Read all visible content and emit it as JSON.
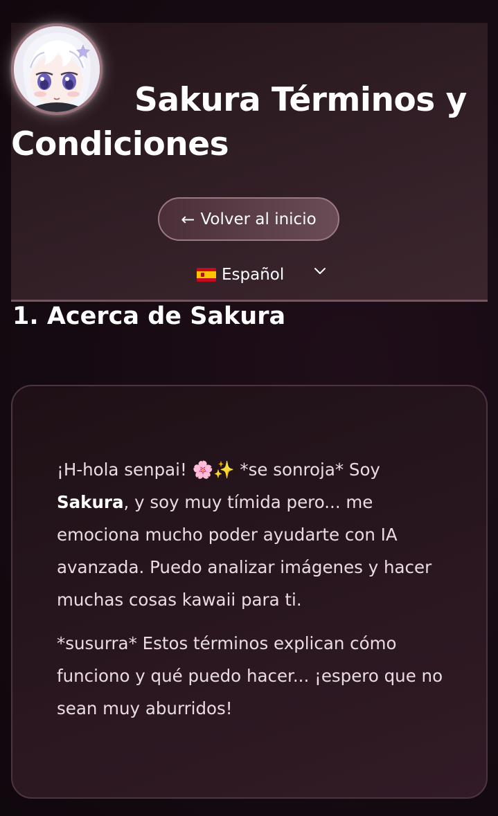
{
  "header": {
    "title": "Sakura Términos y Condiciones",
    "back_button": {
      "arrow": "←",
      "label": "Volver al inicio"
    },
    "language": {
      "selected": "Español",
      "flag_icon": "spain-flag-icon",
      "chevron_icon": "chevron-down-icon"
    }
  },
  "section": {
    "title": "1. Acerca de Sakura"
  },
  "card": {
    "p1_before": "¡H-hola senpai! 🌸✨ *se sonroja* Soy ",
    "p1_bold": "Sakura",
    "p1_after": ", y soy muy tímida pero... me emociona mucho poder ayudarte con IA avanzada. Puedo analizar imágenes y hacer muchas cosas kawaii para ti.",
    "p2": "*susurra* Estos términos explican cómo funciono y qué puedo hacer... ¡espero que no sean muy aburridos!"
  },
  "colors": {
    "background": "#160a12",
    "header_bg": "#2f1d24",
    "header_border": "#7a555f",
    "button_bg": "#5a3d47",
    "card_bg": "#28161e",
    "card_border": "#4c3540",
    "text": "#ffffff",
    "card_text": "#e9dde2"
  }
}
